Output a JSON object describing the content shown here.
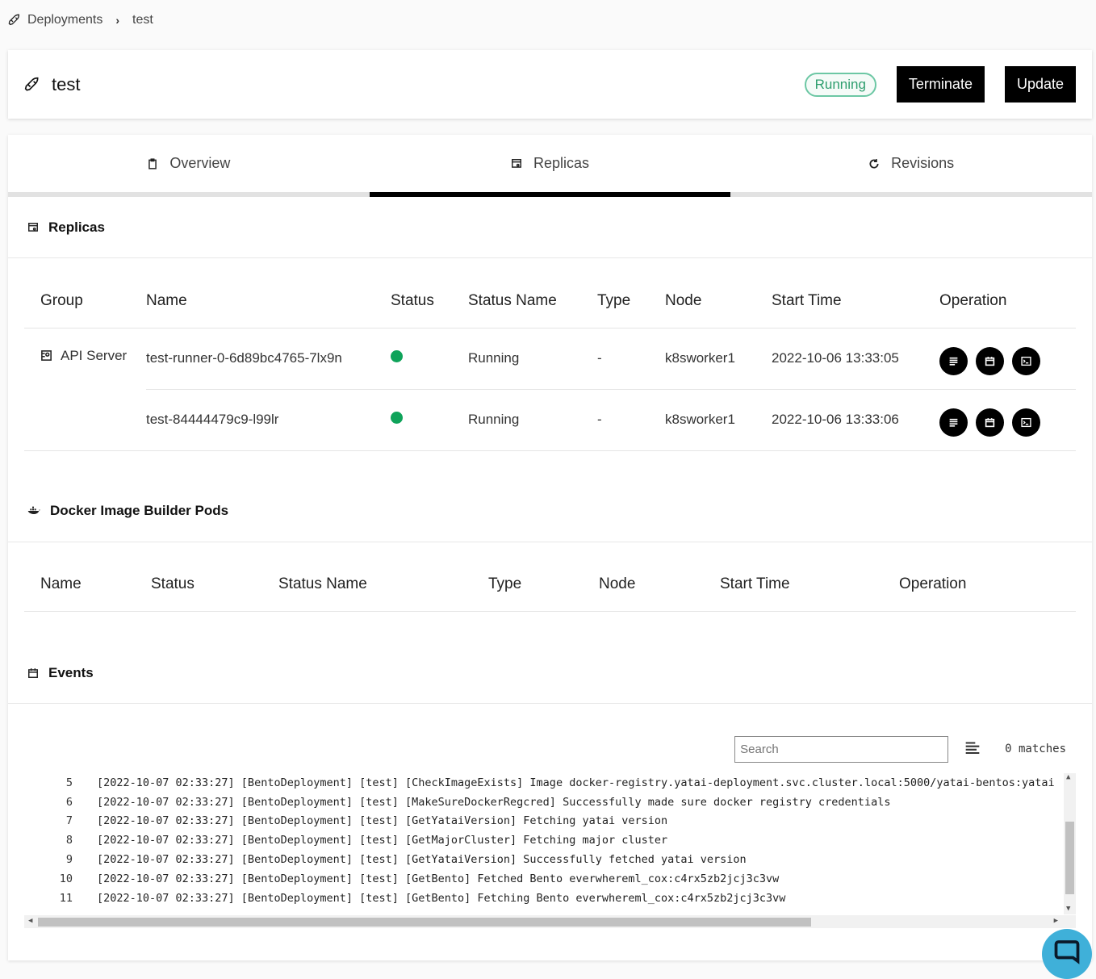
{
  "breadcrumb": {
    "root": "Deployments",
    "current": "test"
  },
  "header": {
    "title": "test",
    "status": "Running",
    "terminate_label": "Terminate",
    "update_label": "Update"
  },
  "tabs": [
    {
      "label": "Overview",
      "icon": "clipboard-icon"
    },
    {
      "label": "Replicas",
      "icon": "replicas-icon",
      "active": true
    },
    {
      "label": "Revisions",
      "icon": "refresh-icon"
    }
  ],
  "replicas": {
    "title": "Replicas",
    "columns": [
      "Group",
      "Name",
      "Status",
      "Status Name",
      "Type",
      "Node",
      "Start Time",
      "Operation"
    ],
    "group": "API Server",
    "rows": [
      {
        "name": "test-runner-0-6d89bc4765-7lx9n",
        "status_name": "Running",
        "type": "-",
        "node": "k8sworker1",
        "start_time": "2022-10-06 13:33:05"
      },
      {
        "name": "test-84444479c9-l99lr",
        "status_name": "Running",
        "type": "-",
        "node": "k8sworker1",
        "start_time": "2022-10-06 13:33:06"
      }
    ],
    "status_color": "#0fa35a"
  },
  "builder": {
    "title": "Docker Image Builder Pods",
    "columns": [
      "Name",
      "Status",
      "Status Name",
      "Type",
      "Node",
      "Start Time",
      "Operation"
    ]
  },
  "events": {
    "title": "Events",
    "search_placeholder": "Search",
    "matches": "0 matches",
    "lines": [
      {
        "n": "5",
        "text": "[2022-10-07 02:33:27] [BentoDeployment] [test] [CheckImageExists] Image docker-registry.yatai-deployment.svc.cluster.local:5000/yatai-bentos:yatai"
      },
      {
        "n": "6",
        "text": "[2022-10-07 02:33:27] [BentoDeployment] [test] [MakeSureDockerRegcred] Successfully made sure docker registry credentials"
      },
      {
        "n": "7",
        "text": "[2022-10-07 02:33:27] [BentoDeployment] [test] [GetYataiVersion] Fetching yatai version"
      },
      {
        "n": "8",
        "text": "[2022-10-07 02:33:27] [BentoDeployment] [test] [GetMajorCluster] Fetching major cluster"
      },
      {
        "n": "9",
        "text": "[2022-10-07 02:33:27] [BentoDeployment] [test] [GetYataiVersion] Successfully fetched yatai version"
      },
      {
        "n": "10",
        "text": "[2022-10-07 02:33:27] [BentoDeployment] [test] [GetBento] Fetched Bento everwhereml_cox:c4rx5zb2jcj3c3vw"
      },
      {
        "n": "11",
        "text": "[2022-10-07 02:33:27] [BentoDeployment] [test] [GetBento] Fetching Bento everwhereml_cox:c4rx5zb2jcj3c3vw"
      }
    ]
  },
  "colors": {
    "accent": "#000000",
    "running_border": "#6cc7a4",
    "chat": "#3fb0d9"
  }
}
